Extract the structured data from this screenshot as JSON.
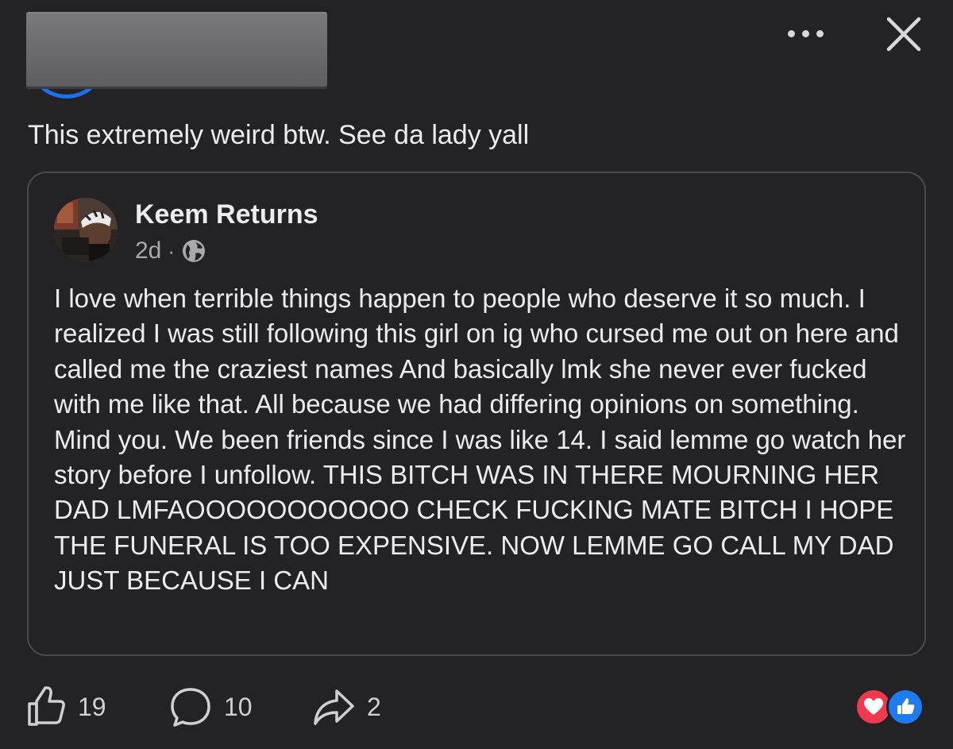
{
  "header": {
    "avatar_ring_color": "#1d6ff2",
    "more_icon": "more-horizontal-icon",
    "close_icon": "close-icon"
  },
  "post": {
    "text": "This extremely weird btw. See da lady yall"
  },
  "shared_post": {
    "author": "Keem Returns",
    "time": "2d",
    "separator": "·",
    "privacy_icon": "globe-icon",
    "body": "I love when terrible things happen to people who deserve it so much. I realized I was still following this girl on ig who cursed me out on here and called me the craziest names And basically lmk she never ever fucked with me like that. All because we had differing opinions on something. Mind you. We been friends since I was like 14. I said lemme go watch her story before I unfollow. THIS BITCH WAS IN THERE MOURNING HER DAD LMFAOOOOOOOOOOO CHECK FUCKING MATE BITCH I HOPE THE FUNERAL IS TOO EXPENSIVE. NOW LEMME GO CALL MY DAD JUST BECAUSE I CAN"
  },
  "actions": {
    "like_count": "19",
    "comment_count": "10",
    "share_count": "2"
  },
  "reactions": {
    "love_color": "#f0394f",
    "like_color": "#1e7cf2"
  }
}
